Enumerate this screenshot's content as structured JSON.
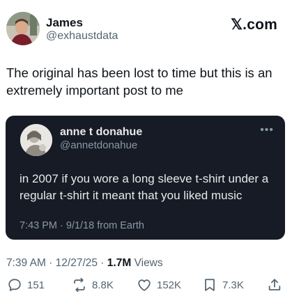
{
  "author": {
    "name": "James",
    "handle": "@exhaustdata"
  },
  "brand": "𝕏.com",
  "post": {
    "text": "The original has been lost to time but this is an extremely important post to me",
    "time": "7:39 AM",
    "date": "12/27/25",
    "views_count": "1.7M",
    "views_label": "Views"
  },
  "quoted": {
    "name": "anne t donahue",
    "handle": "@annetdonahue",
    "more": "•••",
    "text": "in 2007 if you wore a long sleeve t-shirt under a regular t-shirt it meant that you liked music",
    "meta": "7:43 PM · 9/1/18 from Earth"
  },
  "actions": {
    "replies": "151",
    "reposts": "8.8K",
    "likes": "152K",
    "bookmarks": "7.3K"
  },
  "icons": {
    "reply": "reply-icon",
    "repost": "repost-icon",
    "like": "like-icon",
    "bookmark": "bookmark-icon",
    "share": "share-icon"
  },
  "colors": {
    "card_bg": "#161b26",
    "secondary_text": "#536471"
  }
}
